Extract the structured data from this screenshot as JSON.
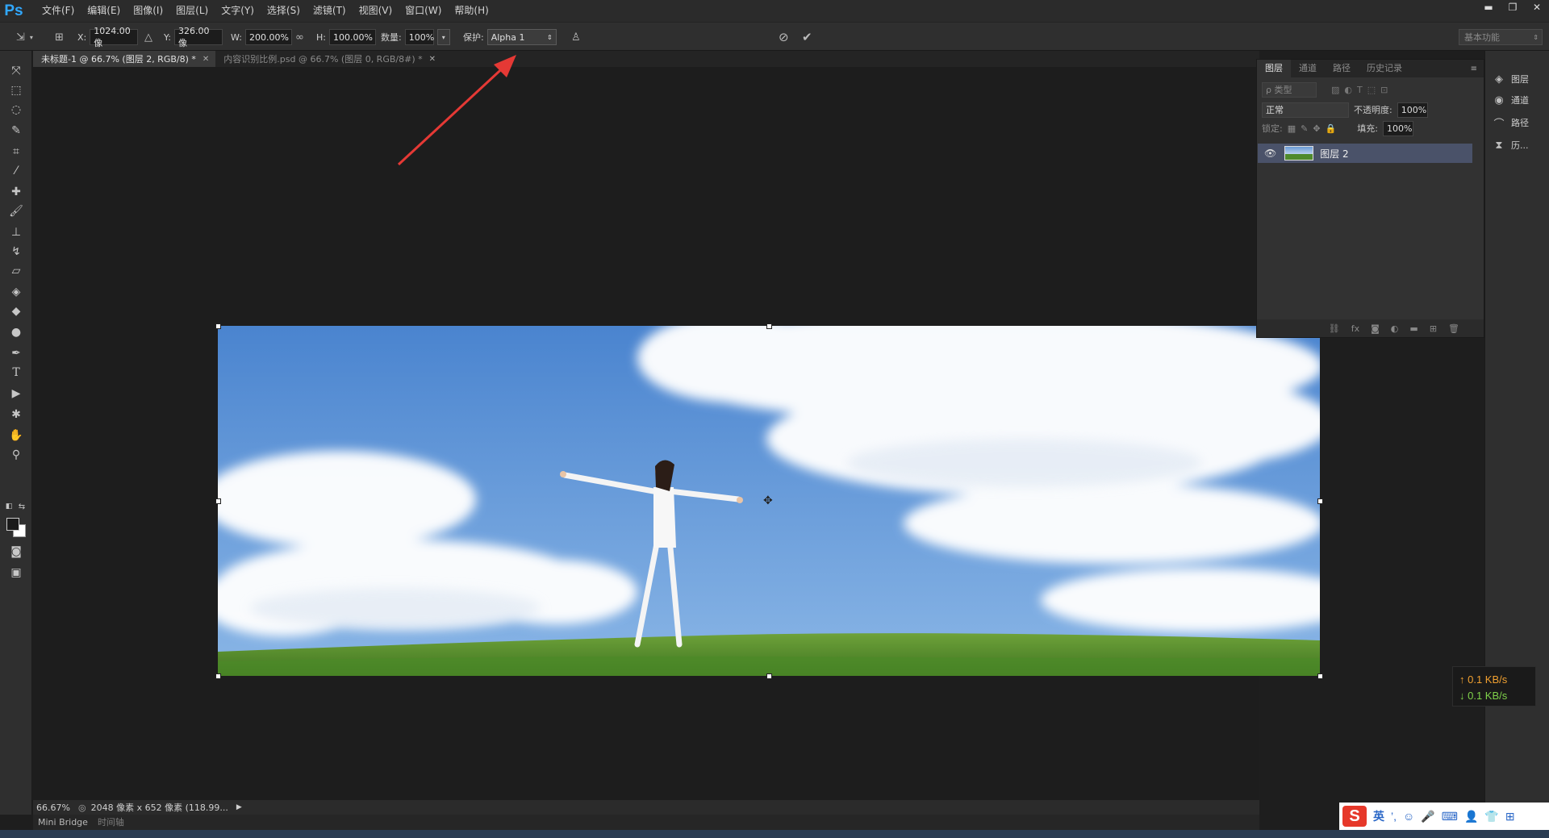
{
  "app": {
    "logo": "Ps"
  },
  "menu": [
    "文件(F)",
    "编辑(E)",
    "图像(I)",
    "图层(L)",
    "文字(Y)",
    "选择(S)",
    "滤镜(T)",
    "视图(V)",
    "窗口(W)",
    "帮助(H)"
  ],
  "window_controls": {
    "minimize": "▬",
    "restore": "❐",
    "close": "✕"
  },
  "options": {
    "x_label": "X:",
    "x_value": "1024.00 像",
    "y_label": "Y:",
    "y_value": "326.00 像",
    "w_label": "W:",
    "w_value": "200.00%",
    "h_label": "H:",
    "h_value": "100.00%",
    "amount_label": "数量:",
    "amount_value": "100%",
    "protect_label": "保护:",
    "protect_value": "Alpha 1",
    "workspace": "基本功能"
  },
  "tabs": [
    {
      "label": "未标题-1 @ 66.7% (图层 2, RGB/8) *"
    },
    {
      "label": "内容识别比例.psd @ 66.7% (图层 0, RGB/8#) *"
    }
  ],
  "layers_panel": {
    "tabs": [
      "图层",
      "通道",
      "路径",
      "历史记录"
    ],
    "filter_label": "ρ 类型",
    "blend_mode": "正常",
    "opacity_label": "不透明度:",
    "opacity_value": "100%",
    "lock_label": "锁定:",
    "fill_label": "填充:",
    "fill_value": "100%",
    "layers": [
      {
        "name": "图层 2"
      }
    ]
  },
  "dock": [
    "图层",
    "通道",
    "路径",
    "历..."
  ],
  "speed": {
    "up": "↑ 0.1 KB/s",
    "down": "↓ 0.1 KB/s"
  },
  "status": {
    "zoom": "66.67%",
    "info": "2048 像素 x 652 像素 (118.99..."
  },
  "bottom_tabs": [
    "Mini Bridge",
    "时间轴"
  ],
  "ime": {
    "logo": "S",
    "lang": "英"
  },
  "colors": {
    "accent": "#31a8ff",
    "selected_layer": "#4a5269",
    "annotation_arrow": "#e53935"
  }
}
